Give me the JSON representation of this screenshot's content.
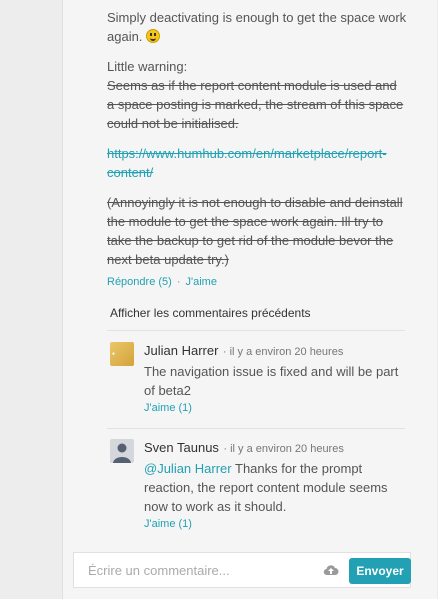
{
  "post": {
    "line1": "Simply deactivating is enough to get the space work again.",
    "warning_label": "Little warning:",
    "warning_text": "Seems as if the report content module is used and a space posting is marked, the stream of this space could not be initialised.",
    "link": "https://www.humhub.com/en/marketplace/report-content/",
    "note": "(Annoyingly it is not enough to disable and deinstall the module to get the space work again. Ill try to take the backup to get rid of the module bevor the next beta update try.)",
    "reply_label": "Répondre (5)",
    "like_label": "J'aime",
    "separator": "·"
  },
  "show_previous": "Afficher les commentaires précédents",
  "comments": [
    {
      "name": "Julian Harrer",
      "time": "· il y a environ 20 heures",
      "text": "The navigation issue is fixed and will be part of beta2",
      "like": "J'aime (1)"
    },
    {
      "name": "Sven Taunus",
      "time": "· il y a environ 20 heures",
      "mention": "@Julian Harrer",
      "text": " Thanks for the prompt reaction, the report content module seems now to work as it should.",
      "like": "J'aime (1)"
    }
  ],
  "composer": {
    "placeholder": "Écrire un commentaire...",
    "send_label": "Envoyer"
  },
  "icons": {
    "smiley": "smiley-icon",
    "upload": "cloud-upload-icon",
    "avatar_default": "user-silhouette-icon"
  },
  "colors": {
    "accent": "#21a1b3"
  }
}
